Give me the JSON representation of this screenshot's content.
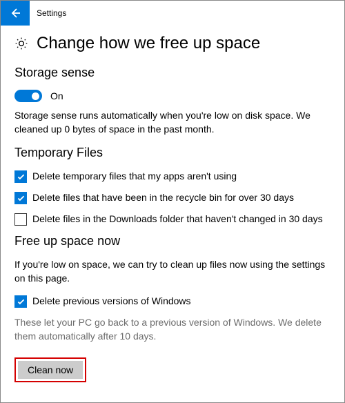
{
  "header": {
    "title": "Settings"
  },
  "page": {
    "title": "Change how we free up space"
  },
  "storage_sense": {
    "heading": "Storage sense",
    "toggle_label": "On",
    "description": "Storage sense runs automatically when you're low on disk space. We cleaned up 0 bytes of space in the past month."
  },
  "temp_files": {
    "heading": "Temporary Files",
    "items": [
      {
        "label": "Delete temporary files that my apps aren't using",
        "checked": true
      },
      {
        "label": "Delete files that have been in the recycle bin for over 30 days",
        "checked": true
      },
      {
        "label": "Delete files in the Downloads folder that haven't changed in 30 days",
        "checked": false
      }
    ]
  },
  "free_up": {
    "heading": "Free up space now",
    "description": "If you're low on space, we can try to clean up files now using the settings on this page.",
    "checkbox_label": "Delete previous versions of Windows",
    "note": "These let your PC go back to a previous version of Windows. We delete them automatically after 10 days.",
    "button_label": "Clean now"
  }
}
